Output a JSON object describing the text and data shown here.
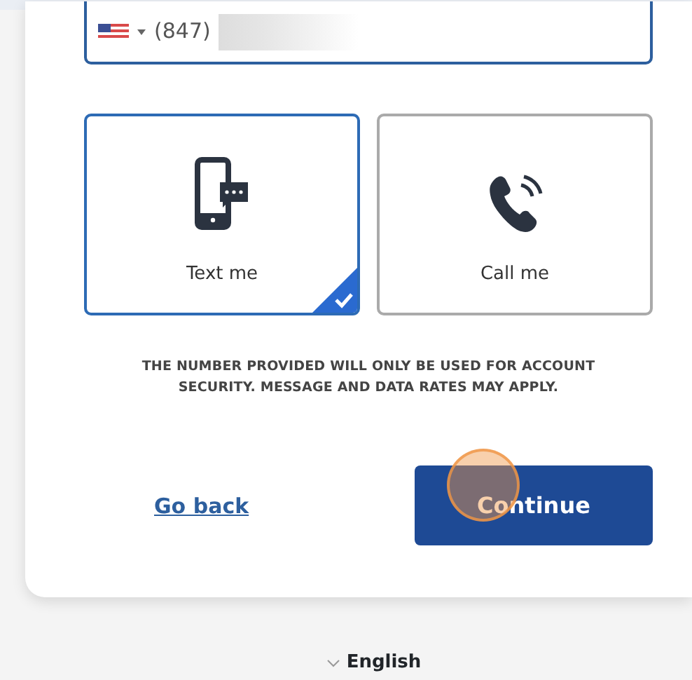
{
  "phone_field": {
    "value": "(847)"
  },
  "options": [
    {
      "label": "Text me",
      "kind": "sms",
      "selected": true
    },
    {
      "label": "Call me",
      "kind": "call",
      "selected": false
    }
  ],
  "disclaimer": "THE NUMBER PROVIDED WILL ONLY BE USED FOR ACCOUNT SECURITY. MESSAGE AND DATA RATES MAY APPLY.",
  "back_link": "Go back",
  "continue_button": "Continue",
  "language": "English"
}
